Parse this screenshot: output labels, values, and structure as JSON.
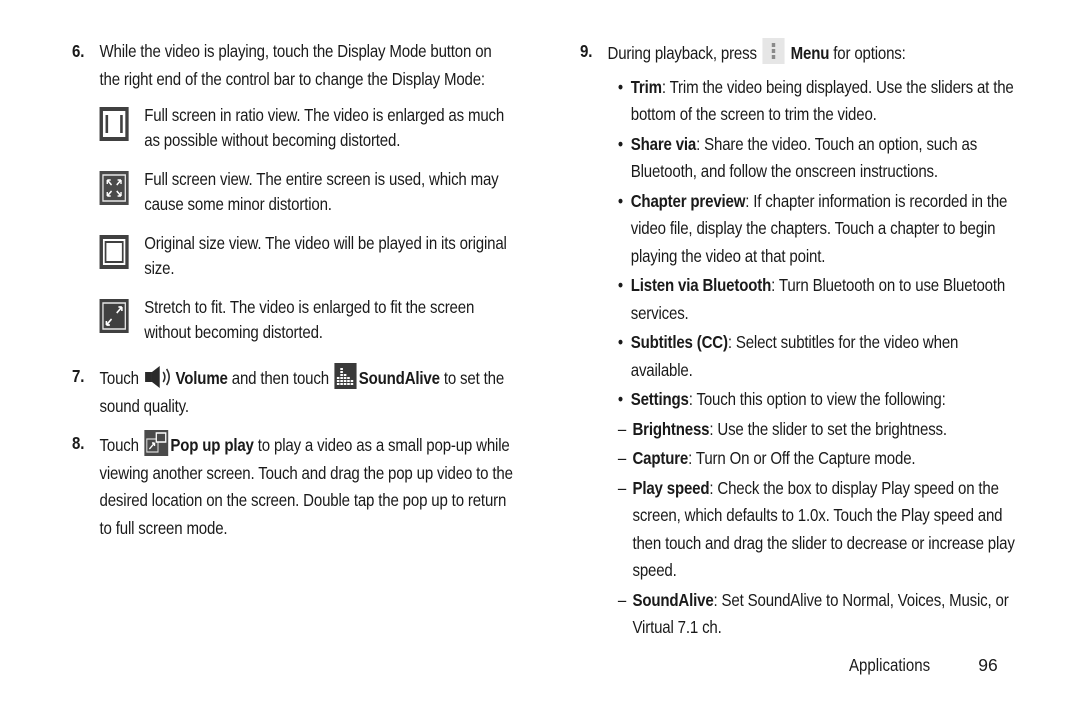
{
  "left": {
    "step6": {
      "number": "6.",
      "text": "While the video is playing, touch the Display Mode button on the right end of the control bar to change the Display Mode:",
      "modes": [
        {
          "icon": "full-screen-ratio-icon",
          "text": "Full screen in ratio view. The video is enlarged as much as possible without becoming distorted."
        },
        {
          "icon": "full-screen-icon",
          "text": "Full screen view. The entire screen is used, which may cause some minor distortion."
        },
        {
          "icon": "original-size-icon",
          "text": "Original size view. The video will be played in its original size."
        },
        {
          "icon": "stretch-to-fit-icon",
          "text": "Stretch to fit. The video is enlarged to fit the screen without becoming distorted."
        }
      ]
    },
    "step7": {
      "number": "7.",
      "t1": "Touch ",
      "volume_icon": "volume-icon",
      "b1": "Volume",
      "t2": " and then touch ",
      "soundalive_icon": "soundalive-icon",
      "b2": "SoundAlive",
      "t3": " to set the sound quality."
    },
    "step8": {
      "number": "8.",
      "t1": "Touch ",
      "popup_icon": "popup-play-icon",
      "b1": "Pop up play",
      "t2": " to play a video as a small pop-up while viewing another screen. Touch and drag the pop up video to the desired location on the screen. Double tap the pop up to return to full screen mode."
    }
  },
  "right": {
    "step9": {
      "number": "9.",
      "t1": "During playback, press ",
      "menu_icon": "menu-icon",
      "b1": "Menu",
      "t2": " for options:",
      "bullets": [
        {
          "term": "Trim",
          "desc": ": Trim the video being displayed. Use the sliders at the bottom of the screen to trim the video."
        },
        {
          "term": "Share via",
          "desc": ": Share the video. Touch an option, such as Bluetooth, and follow the onscreen instructions."
        },
        {
          "term": "Chapter preview",
          "desc": ": If chapter information is recorded in the video file, display the chapters. Touch a chapter to begin playing the video at that point."
        },
        {
          "term": "Listen via Bluetooth",
          "desc": ": Turn Bluetooth on to use Bluetooth services."
        },
        {
          "term": "Subtitles (CC)",
          "desc": ": Select subtitles for the video when available."
        },
        {
          "term": "Settings",
          "desc": ": Touch this option to view the following:"
        }
      ],
      "settings": [
        {
          "term": "Brightness",
          "desc": ": Use the slider to set the brightness."
        },
        {
          "term": "Capture",
          "desc": ": Turn On or Off the Capture mode."
        },
        {
          "term": "Play speed",
          "desc": ": Check the box to display Play speed on the screen, which defaults to 1.0x. Touch the Play speed and then touch and drag the slider to decrease or increase play speed."
        },
        {
          "term": "SoundAlive",
          "desc": ": Set SoundAlive to Normal, Voices, Music, or Virtual 7.1 ch."
        }
      ]
    }
  },
  "glyphs": {
    "bullet": "•",
    "dash": "–"
  },
  "footer": {
    "section": "Applications",
    "page": "96"
  }
}
